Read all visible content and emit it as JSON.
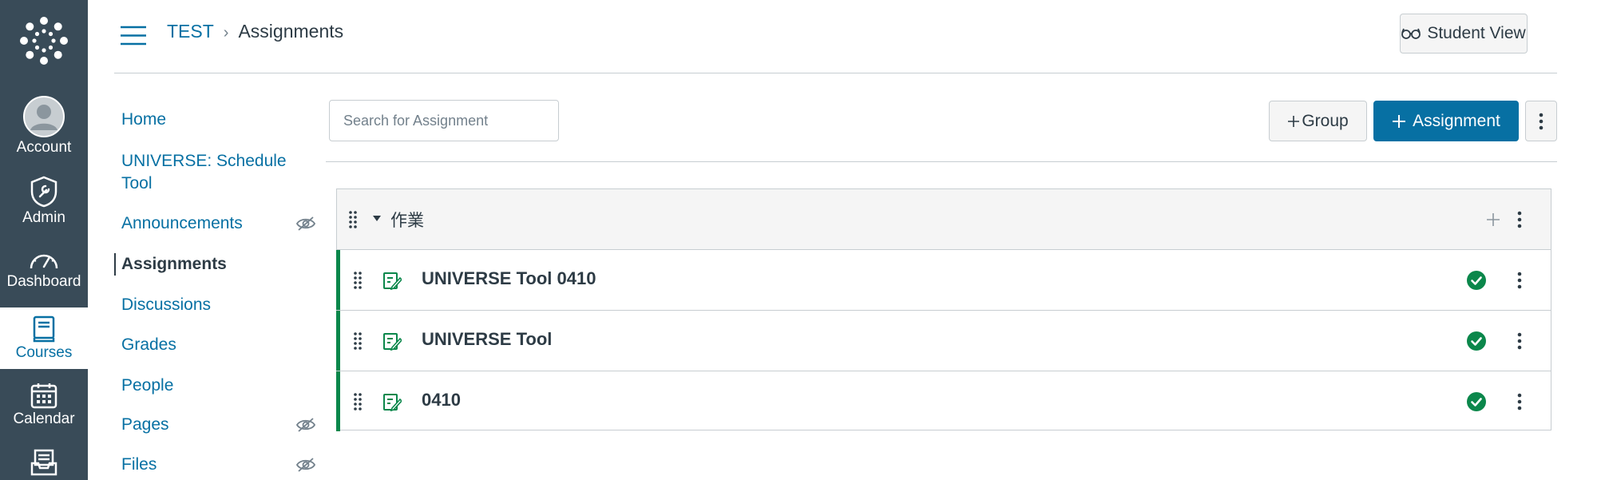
{
  "global_nav": {
    "items": [
      {
        "label": "Account"
      },
      {
        "label": "Admin"
      },
      {
        "label": "Dashboard"
      },
      {
        "label": "Courses"
      },
      {
        "label": "Calendar"
      }
    ]
  },
  "header": {
    "breadcrumb": {
      "course": "TEST",
      "separator": "›",
      "current": "Assignments"
    },
    "student_view_label": "Student View"
  },
  "course_nav": {
    "items": [
      {
        "label": "Home",
        "hidden_icon": false
      },
      {
        "label": "UNIVERSE: Schedule Tool",
        "hidden_icon": false
      },
      {
        "label": "Announcements",
        "hidden_icon": true
      },
      {
        "label": "Assignments",
        "hidden_icon": false,
        "active": true
      },
      {
        "label": "Discussions",
        "hidden_icon": false
      },
      {
        "label": "Grades",
        "hidden_icon": false
      },
      {
        "label": "People",
        "hidden_icon": false
      },
      {
        "label": "Pages",
        "hidden_icon": true
      },
      {
        "label": "Files",
        "hidden_icon": true
      }
    ]
  },
  "toolbar": {
    "search_placeholder": "Search for Assignment",
    "search_value": "",
    "group_button": "Group",
    "assignment_button": "Assignment"
  },
  "assignment_group": {
    "title": "作業",
    "assignments": [
      {
        "title": "UNIVERSE Tool 0410",
        "published": true
      },
      {
        "title": "UNIVERSE Tool",
        "published": true
      },
      {
        "title": "0410",
        "published": true
      }
    ]
  },
  "colors": {
    "nav_bg": "#394b58",
    "link": "#0770a3",
    "primary_button": "#0770a3",
    "published_green": "#0b874b"
  }
}
